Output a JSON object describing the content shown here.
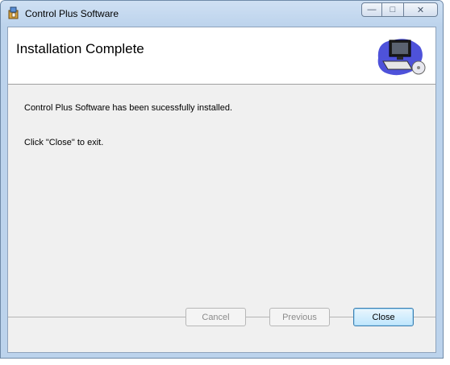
{
  "window": {
    "title": "Control Plus Software",
    "caption_buttons": {
      "minimize": "—",
      "maximize": "□",
      "close": "✕"
    }
  },
  "banner": {
    "title": "Installation Complete",
    "graphic_icon": "computer-icon"
  },
  "body": {
    "line1": "Control Plus Software has been sucessfully installed.",
    "line2": "Click \"Close\" to exit."
  },
  "buttons": {
    "cancel": "Cancel",
    "previous": "Previous",
    "close": "Close"
  }
}
